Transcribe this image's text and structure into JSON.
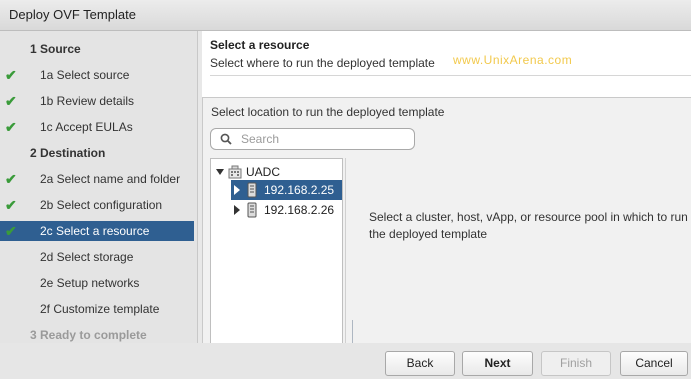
{
  "window": {
    "title": "Deploy OVF Template"
  },
  "steps": [
    {
      "label": "1  Source",
      "kind": "section",
      "done": false,
      "active": false,
      "disabled": false
    },
    {
      "label": "1a  Select source",
      "kind": "sub",
      "done": true,
      "active": false,
      "disabled": false
    },
    {
      "label": "1b  Review details",
      "kind": "sub",
      "done": true,
      "active": false,
      "disabled": false
    },
    {
      "label": "1c  Accept EULAs",
      "kind": "sub",
      "done": true,
      "active": false,
      "disabled": false
    },
    {
      "label": "2  Destination",
      "kind": "section",
      "done": false,
      "active": false,
      "disabled": false
    },
    {
      "label": "2a  Select name and folder",
      "kind": "sub",
      "done": true,
      "active": false,
      "disabled": false
    },
    {
      "label": "2b  Select configuration",
      "kind": "sub",
      "done": true,
      "active": false,
      "disabled": false
    },
    {
      "label": "2c  Select a resource",
      "kind": "sub",
      "done": true,
      "active": true,
      "disabled": false
    },
    {
      "label": "2d  Select storage",
      "kind": "sub",
      "done": false,
      "active": false,
      "disabled": false
    },
    {
      "label": "2e  Setup networks",
      "kind": "sub",
      "done": false,
      "active": false,
      "disabled": false
    },
    {
      "label": "2f  Customize template",
      "kind": "sub",
      "done": false,
      "active": false,
      "disabled": false
    },
    {
      "label": "3  Ready to complete",
      "kind": "section",
      "done": false,
      "active": false,
      "disabled": true
    }
  ],
  "header": {
    "title": "Select a resource",
    "subtitle": "Select where to run the deployed template",
    "watermark": "www.UnixArena.com"
  },
  "panel": {
    "label": "Select location to run the deployed template",
    "search_placeholder": "Search",
    "search_value": "",
    "info": "Select a cluster, host, vApp, or resource pool in which to run the deployed template"
  },
  "tree": [
    {
      "label": "UADC",
      "icon": "datacenter-icon",
      "expanded": true,
      "selected": false
    },
    {
      "label": "192.168.2.25",
      "icon": "host-icon",
      "expanded": false,
      "selected": true
    },
    {
      "label": "192.168.2.26",
      "icon": "host-icon",
      "expanded": false,
      "selected": false
    }
  ],
  "footer": {
    "back": "Back",
    "next": "Next",
    "finish": "Finish",
    "cancel": "Cancel"
  },
  "colors": {
    "accent": "#2f5f91",
    "check": "#3a9b3a",
    "watermark": "#f2c94c"
  }
}
